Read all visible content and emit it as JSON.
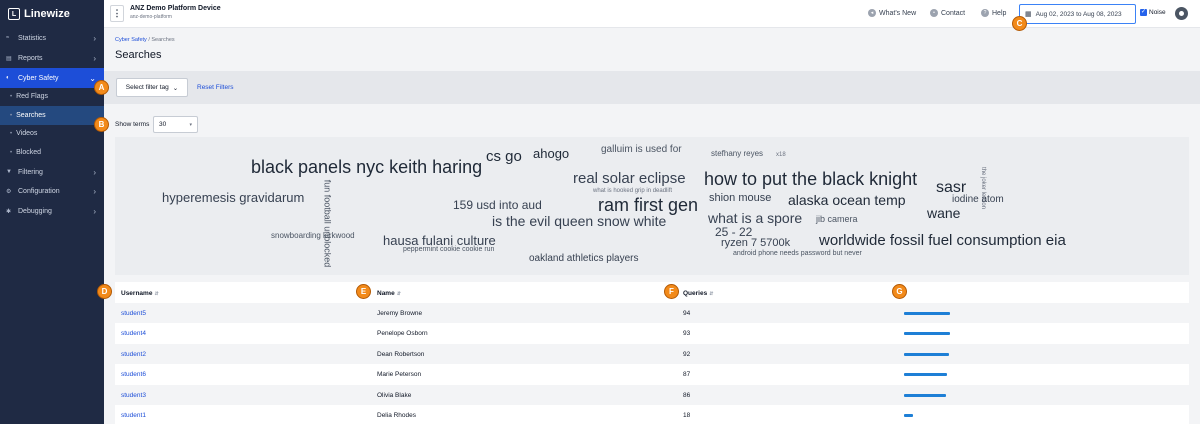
{
  "brand": {
    "name": "Linewize",
    "logo": "L"
  },
  "sidebar": {
    "items": [
      {
        "label": "Statistics",
        "icon": "≈"
      },
      {
        "label": "Reports",
        "icon": "▤"
      },
      {
        "label": "Cyber Safety",
        "icon": "◐"
      },
      {
        "label": "Filtering",
        "icon": "▼"
      },
      {
        "label": "Configuration",
        "icon": "⚙"
      },
      {
        "label": "Debugging",
        "icon": "✱"
      }
    ],
    "cyber_sub": [
      {
        "label": "Red Flags"
      },
      {
        "label": "Searches"
      },
      {
        "label": "Videos"
      },
      {
        "label": "Blocked"
      }
    ],
    "chevron_right": "›",
    "chevron_down": "⌄"
  },
  "topbar": {
    "kebab": "⋮",
    "device_title": "ANZ Demo Platform Device",
    "device_sub": "anz-demo-platform",
    "whats_new": "What's New",
    "contact": "Contact",
    "help": "Help",
    "help_glyph": "?",
    "date_range": "Aug 02, 2023 to Aug 08, 2023",
    "noise": "Noise",
    "check_glyph": "✓"
  },
  "breadcrumb": {
    "parent": "Cyber Safety",
    "sep": "/",
    "current": "Searches"
  },
  "page_title": "Searches",
  "filter": {
    "select_label": "Select filter tag",
    "caret": "⌄",
    "reset_label": "Reset Filters"
  },
  "terms": {
    "label": "Show terms",
    "value": "30",
    "caret": "▾"
  },
  "word_cloud": [
    {
      "text": "black panels nyc keith haring",
      "size": 18
    },
    {
      "text": "cs go",
      "size": 15
    },
    {
      "text": "ahogo",
      "size": 13
    },
    {
      "text": "galluim is used for",
      "size": 10
    },
    {
      "text": "stefhany reyes",
      "size": 8
    },
    {
      "text": "x18",
      "size": 6
    },
    {
      "text": "the joker lesson",
      "size": 6,
      "vertical": true
    },
    {
      "text": "real solar eclipse",
      "size": 15
    },
    {
      "text": "what is hooked grip in deadlift",
      "size": 6
    },
    {
      "text": "how to put the black knight",
      "size": 18
    },
    {
      "text": "sasr",
      "size": 16
    },
    {
      "text": "hyperemesis gravidarum",
      "size": 13
    },
    {
      "text": "fun football unblocked",
      "size": 9,
      "vertical": true
    },
    {
      "text": "159 usd into aud",
      "size": 12
    },
    {
      "text": "ram first gen",
      "size": 18
    },
    {
      "text": "shion mouse",
      "size": 11
    },
    {
      "text": "alaska ocean temp",
      "size": 14
    },
    {
      "text": "iodine atom",
      "size": 10
    },
    {
      "text": "wane",
      "size": 14
    },
    {
      "text": "is the evil queen snow white",
      "size": 14
    },
    {
      "text": "what is a spore",
      "size": 14
    },
    {
      "text": "jib camera",
      "size": 9
    },
    {
      "text": "25 - 22",
      "size": 12
    },
    {
      "text": "snowboarding kirkwood",
      "size": 8
    },
    {
      "text": "hausa fulani culture",
      "size": 13
    },
    {
      "text": "ryzen 7 5700k",
      "size": 11
    },
    {
      "text": "worldwide fossil fuel consumption eia",
      "size": 15
    },
    {
      "text": "peppermint cookie cookie run",
      "size": 7
    },
    {
      "text": "android phone needs password but never",
      "size": 7
    },
    {
      "text": "oakland athletics players",
      "size": 10
    }
  ],
  "table": {
    "headers": {
      "username": "Username",
      "name": "Name",
      "queries": "Queries",
      "sort": "⇵"
    },
    "rows": [
      {
        "username": "student5",
        "name": "Jeremy Browne",
        "queries": "94",
        "fraction": 1.0
      },
      {
        "username": "student4",
        "name": "Penelope Osborn",
        "queries": "93",
        "fraction": 0.99
      },
      {
        "username": "student2",
        "name": "Dean Robertson",
        "queries": "92",
        "fraction": 0.98
      },
      {
        "username": "student6",
        "name": "Marie Peterson",
        "queries": "87",
        "fraction": 0.93
      },
      {
        "username": "student3",
        "name": "Olivia Blake",
        "queries": "86",
        "fraction": 0.91
      },
      {
        "username": "student1",
        "name": "Delia Rhodes",
        "queries": "18",
        "fraction": 0.19
      }
    ]
  },
  "markers": [
    "A",
    "B",
    "C",
    "D",
    "E",
    "F",
    "G"
  ],
  "colors": {
    "accent": "#1d4ed8",
    "bar": "#1e7fd6",
    "marker": "#f28a1a",
    "sidebar": "#1f2a44"
  }
}
